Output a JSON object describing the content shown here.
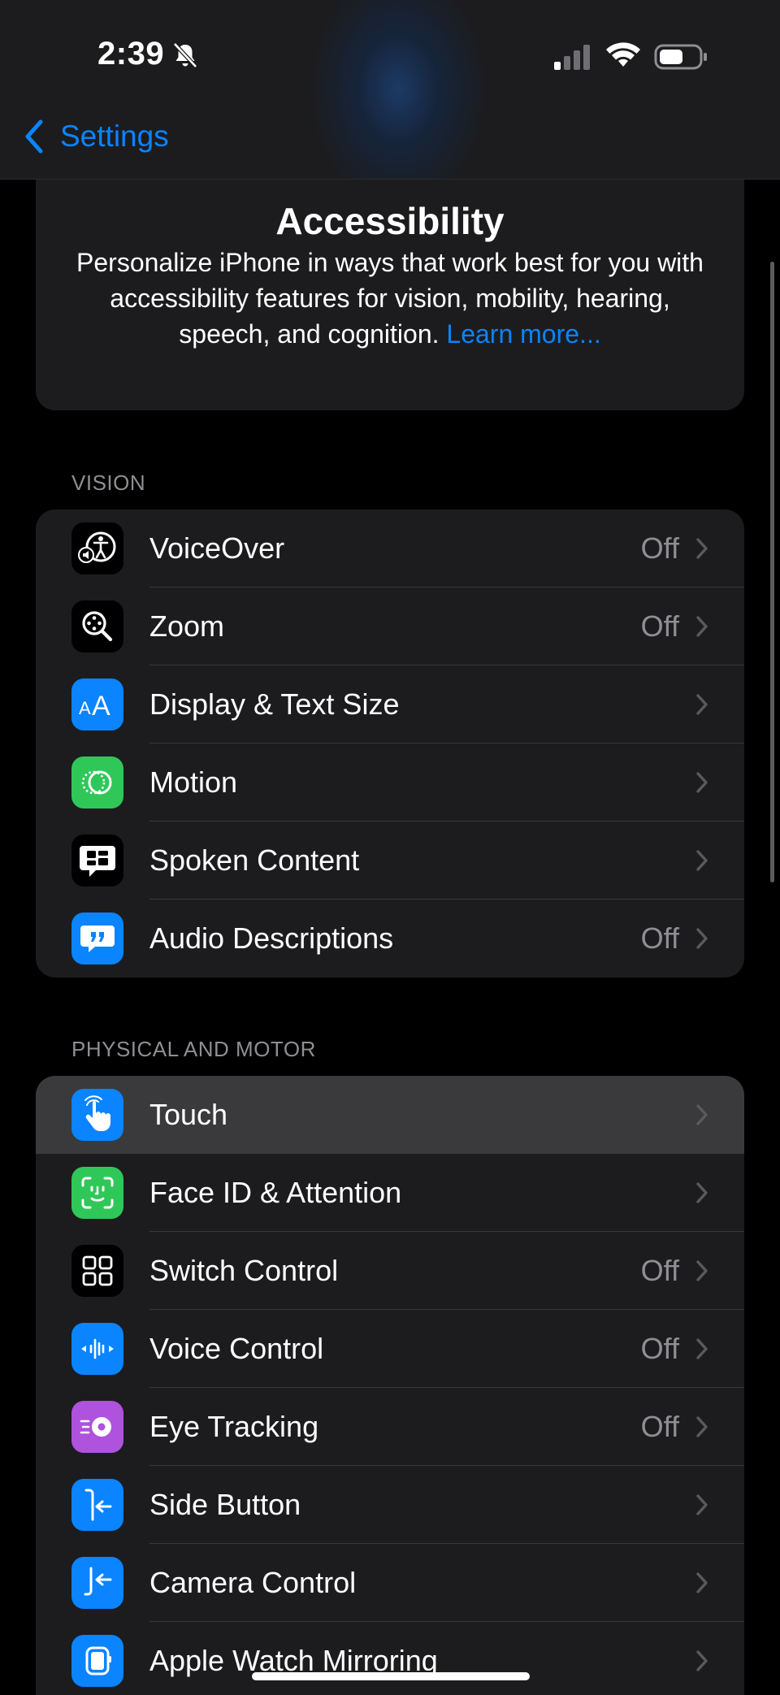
{
  "status_bar": {
    "time": "2:39",
    "icons": [
      "bell-slash-icon",
      "cellular-signal-icon",
      "wifi-icon",
      "battery-icon"
    ]
  },
  "nav": {
    "back_label": "Settings"
  },
  "hero": {
    "title": "Accessibility",
    "description": "Personalize iPhone in ways that work best for you with accessibility features for vision, mobility, hearing, speech, and cognition.",
    "link": "Learn more..."
  },
  "sections": {
    "vision": {
      "header": "VISION",
      "items": [
        {
          "label": "VoiceOver",
          "value": "Off",
          "icon": "voiceover-icon",
          "icon_bg": "#000000"
        },
        {
          "label": "Zoom",
          "value": "Off",
          "icon": "zoom-icon",
          "icon_bg": "#000000"
        },
        {
          "label": "Display & Text Size",
          "value": "",
          "icon": "text-size-icon",
          "icon_bg": "#0a84ff"
        },
        {
          "label": "Motion",
          "value": "",
          "icon": "motion-icon",
          "icon_bg": "#30c759"
        },
        {
          "label": "Spoken Content",
          "value": "",
          "icon": "spoken-content-icon",
          "icon_bg": "#000000"
        },
        {
          "label": "Audio Descriptions",
          "value": "Off",
          "icon": "audio-descriptions-icon",
          "icon_bg": "#0a84ff"
        }
      ]
    },
    "physical": {
      "header": "PHYSICAL AND MOTOR",
      "items": [
        {
          "label": "Touch",
          "value": "",
          "icon": "touch-hand-icon",
          "icon_bg": "#0a84ff"
        },
        {
          "label": "Face ID & Attention",
          "value": "",
          "icon": "face-id-icon",
          "icon_bg": "#30c759"
        },
        {
          "label": "Switch Control",
          "value": "Off",
          "icon": "switch-control-icon",
          "icon_bg": "#000000"
        },
        {
          "label": "Voice Control",
          "value": "Off",
          "icon": "voice-control-icon",
          "icon_bg": "#0a84ff"
        },
        {
          "label": "Eye Tracking",
          "value": "Off",
          "icon": "eye-tracking-icon",
          "icon_bg": "#af52de"
        },
        {
          "label": "Side Button",
          "value": "",
          "icon": "side-button-icon",
          "icon_bg": "#0a84ff"
        },
        {
          "label": "Camera Control",
          "value": "",
          "icon": "camera-control-icon",
          "icon_bg": "#0a84ff"
        },
        {
          "label": "Apple Watch Mirroring",
          "value": "",
          "icon": "apple-watch-icon",
          "icon_bg": "#0a84ff"
        }
      ]
    }
  },
  "colors": {
    "accent": "#0a84ff",
    "background": "#000000",
    "cell": "#1c1c1e",
    "secondary_text": "#8e8e93"
  }
}
